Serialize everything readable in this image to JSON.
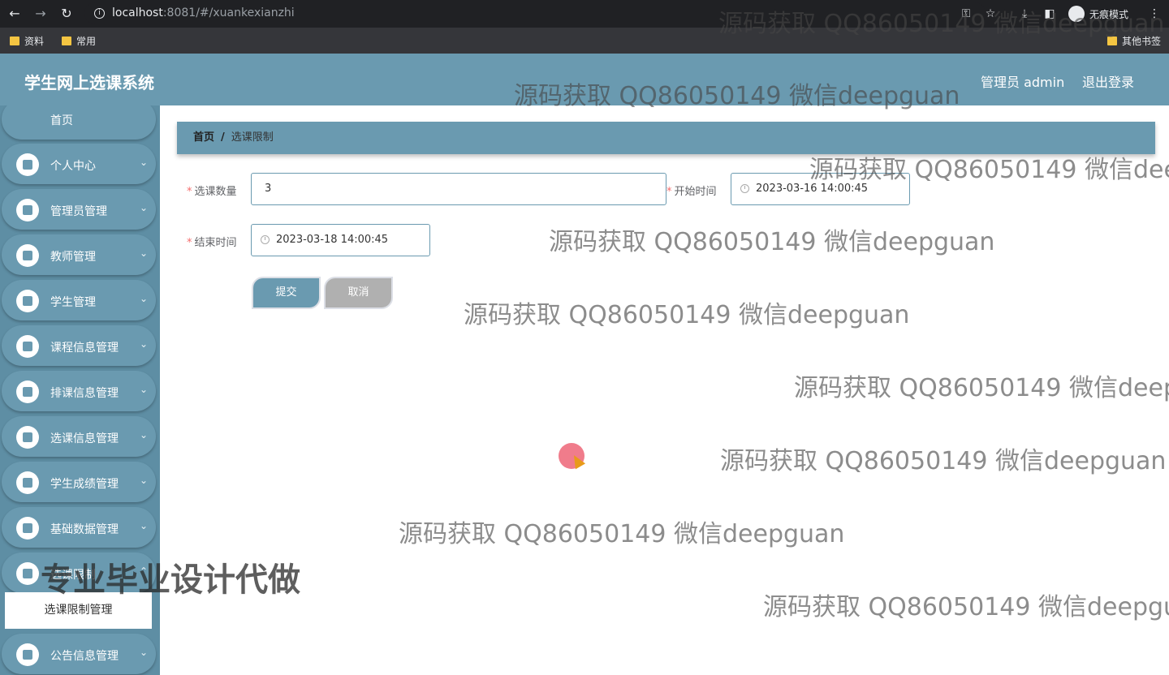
{
  "browser": {
    "url_host": "localhost",
    "url_rest": ":8081/#/xuankexianzhi",
    "incognito_label": "无痕模式",
    "bookmarks": [
      "资料",
      "常用"
    ],
    "other_bookmarks": "其他书签"
  },
  "header": {
    "title": "学生网上选课系统",
    "user": "管理员 admin",
    "logout": "退出登录"
  },
  "sidebar": {
    "home": "首页",
    "items": [
      {
        "label": "个人中心",
        "icon": "user-icon"
      },
      {
        "label": "管理员管理",
        "icon": "briefcase-icon"
      },
      {
        "label": "教师管理",
        "icon": "flag-icon"
      },
      {
        "label": "学生管理",
        "icon": "grid-icon"
      },
      {
        "label": "课程信息管理",
        "icon": "book-icon"
      },
      {
        "label": "排课信息管理",
        "icon": "printer-icon"
      },
      {
        "label": "选课信息管理",
        "icon": "grid-icon"
      },
      {
        "label": "学生成绩管理",
        "icon": "clipboard-icon"
      },
      {
        "label": "基础数据管理",
        "icon": "chart-icon"
      },
      {
        "label": "选课限制",
        "icon": "grid-icon"
      }
    ],
    "active_sub": "选课限制管理",
    "last_item": {
      "label": "公告信息管理",
      "icon": "message-icon"
    }
  },
  "breadcrumb": {
    "home": "首页",
    "separator": "/",
    "current": "选课限制"
  },
  "form": {
    "count_label": "选课数量",
    "count_value": "3",
    "start_label": "开始时间",
    "start_value": "2023-03-16 14:00:45",
    "end_label": "结束时间",
    "end_value": "2023-03-18 14:00:45",
    "required_mark": "*",
    "submit": "提交",
    "cancel": "取消"
  },
  "watermarks": {
    "text": "源码获取 QQ86050149 微信deepguan",
    "truncated_1": "源码获取 QQ86050149 微信dee",
    "truncated_2": "源码获取 QQ86050149 微信deep",
    "truncated_3": "源码获取 QQ86050149 微信deepgu",
    "overlay": "专业毕业设计代做"
  },
  "colors": {
    "primary": "#6a9ab0",
    "sidebar": "#5e8ea4",
    "required": "#f56c6c"
  }
}
